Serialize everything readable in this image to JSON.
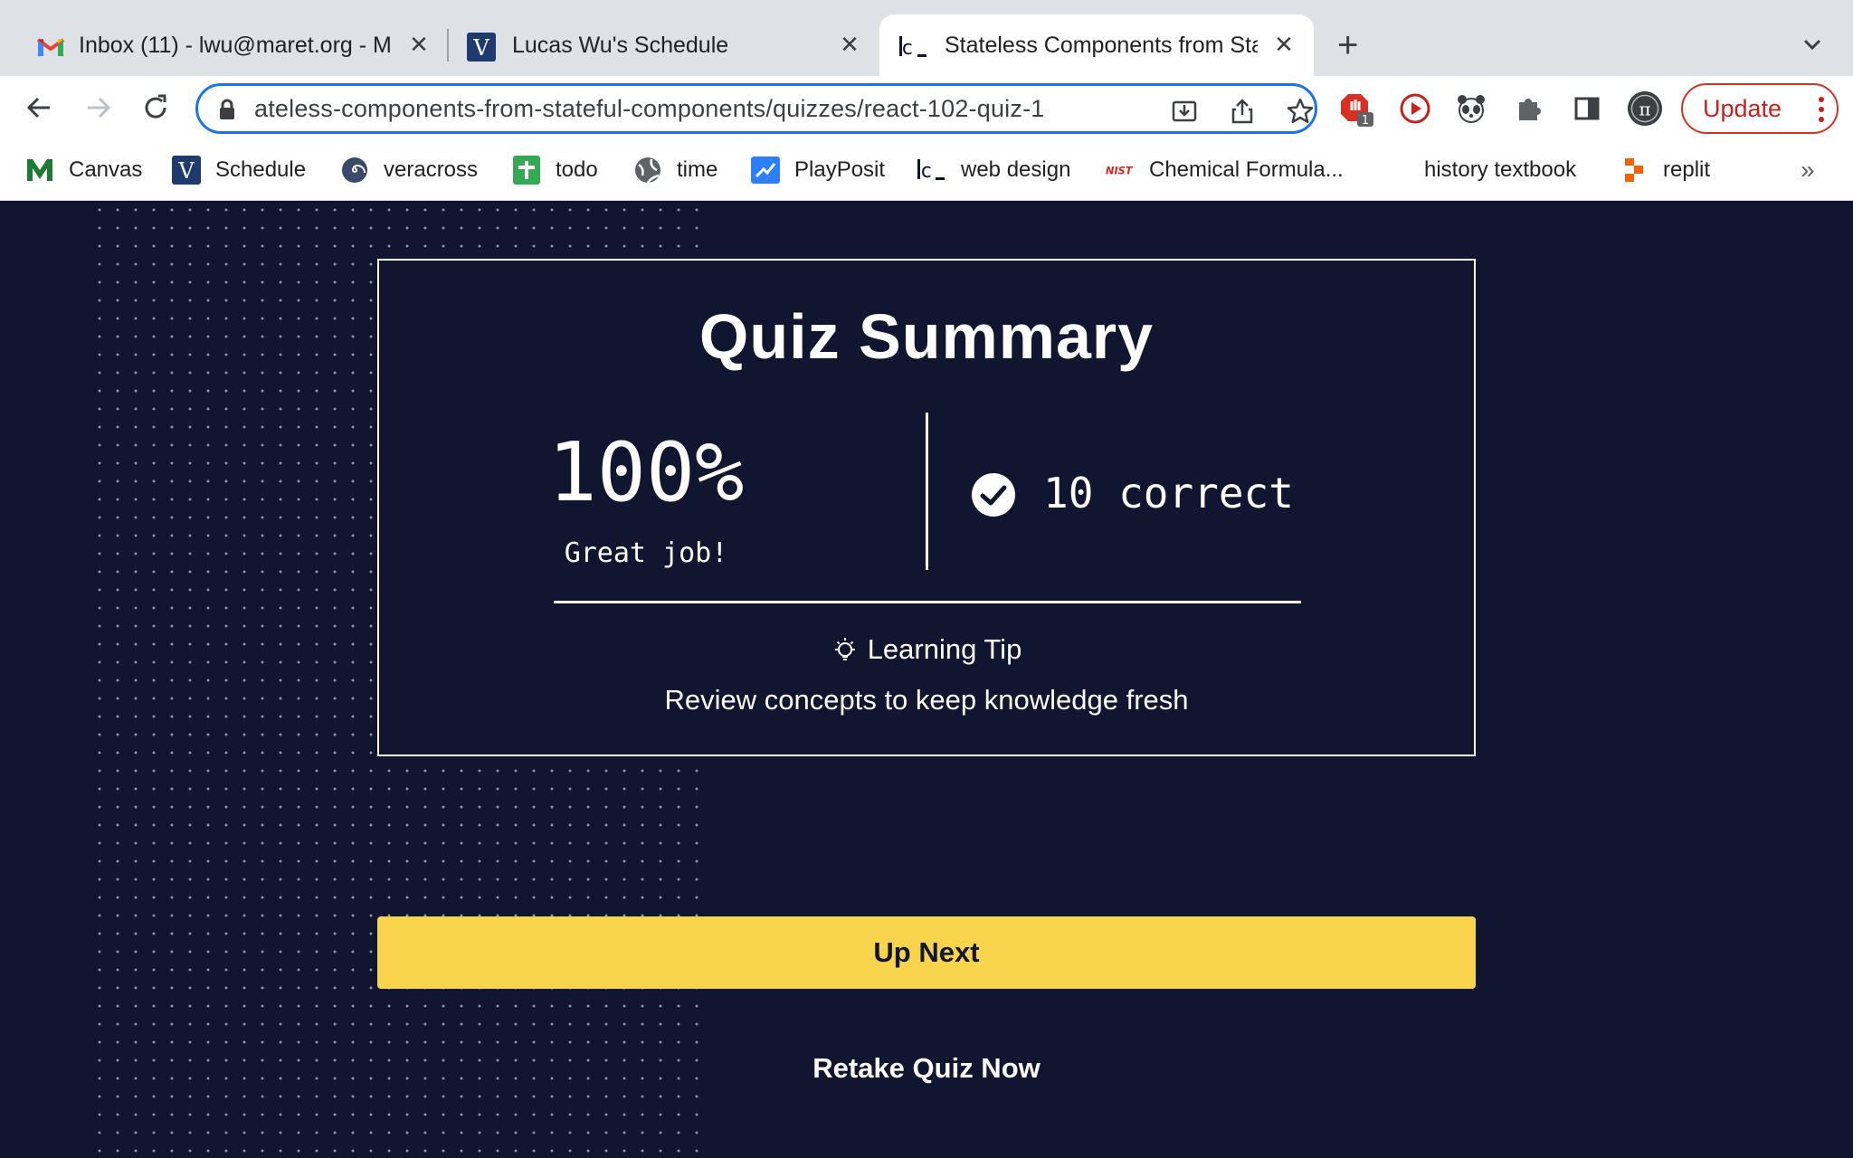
{
  "tabs": [
    {
      "title": "Inbox (11) - lwu@maret.org - M",
      "icon": "gmail-icon",
      "active": false
    },
    {
      "title": "Lucas Wu's Schedule",
      "icon": "veracross-v-icon",
      "active": false
    },
    {
      "title": "Stateless Components from Sta",
      "icon": "codecademy-icon",
      "active": true
    }
  ],
  "toolbar": {
    "url": "ateless-components-from-stateful-components/quizzes/react-102-quiz-1",
    "update_label": "Update",
    "extension_badge": "1"
  },
  "bookmarks": [
    {
      "label": "Canvas",
      "icon": "canvas-m-icon",
      "color": "#1e7b34"
    },
    {
      "label": "Schedule",
      "icon": "veracross-v-icon",
      "color": "#1f3a6e"
    },
    {
      "label": "veracross",
      "icon": "spiral-icon",
      "color": "#3a4a6b"
    },
    {
      "label": "todo",
      "icon": "sheets-plus-icon",
      "color": "#34a853"
    },
    {
      "label": "time",
      "icon": "globe-icon",
      "color": "#5f6368"
    },
    {
      "label": "PlayPosit",
      "icon": "playposit-icon",
      "color": "#2d7ff9"
    },
    {
      "label": "web design",
      "icon": "codecademy-icon",
      "color": "#10162f"
    },
    {
      "label": "Chemical Formula...",
      "icon": "nist-icon",
      "color": "#e2231a"
    },
    {
      "label": "history textbook",
      "icon": "",
      "color": ""
    },
    {
      "label": "replit",
      "icon": "replit-icon",
      "color": "#f26207"
    }
  ],
  "quiz": {
    "title": "Quiz Summary",
    "score": "100%",
    "score_message": "Great job!",
    "correct_text": "10 correct",
    "tip_heading": "Learning Tip",
    "tip_body": "Review concepts to keep knowledge fresh",
    "up_next_label": "Up Next",
    "retake_label": "Retake Quiz Now"
  },
  "colors": {
    "page_bg": "#10162f",
    "accent_yellow": "#f7d44c",
    "omnibox_focus": "#1a73e8",
    "update_red": "#c5221f"
  }
}
